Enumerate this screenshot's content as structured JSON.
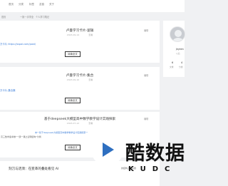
{
  "nav": {
    "items": [
      "首页",
      "分类",
      "标签",
      "友链",
      "关于"
    ]
  },
  "breadcrumb": [
    "首页",
    "",
    "一篇一手学全",
    "个人学习笔记"
  ],
  "posts": [
    {
      "title": "卢曼学习卡片-逻辑",
      "meta": [
        "2023-09-14",
        "",
        "",
        "查看"
      ],
      "tag": "编辑",
      "link_text": "万卡片 https://sspai.com/post/",
      "button": "阅读全文"
    },
    {
      "title": "卢曼学习卡片-集合",
      "meta": [
        "2023-09-10",
        "",
        "",
        "查看"
      ],
      "tag": "编辑",
      "link_text": "万卡片-集合篇",
      "button": "阅读全文"
    },
    {
      "title": "基于deepseek大模型高中数学教学设计实践探索",
      "meta": [
        "2023-07-12",
        "",
        "",
        "查看"
      ],
      "tag": "编辑",
      "excerpt1": "本\"\"基于deepseek大模型高中数学教学设计实践探索\"\"",
      "excerpt2": "高三数学备考卷\"一题一课之证明结构\"为例",
      "button": "阅读全文"
    },
    {
      "title": "刻刀与涟漪：在变革的叠处看见 AI",
      "meta": [
        "",
        "",
        ""
      ],
      "excerpt1": "的结构上是实践"
    }
  ],
  "sidebar": {
    "username": "Jeyeen",
    "description": "以后",
    "stats": [
      {
        "value": "6",
        "label": "文章"
      },
      {
        "value": "4",
        "label": "分类"
      }
    ]
  },
  "watermark": {
    "cn": "酷数据",
    "en": "KUDC"
  }
}
